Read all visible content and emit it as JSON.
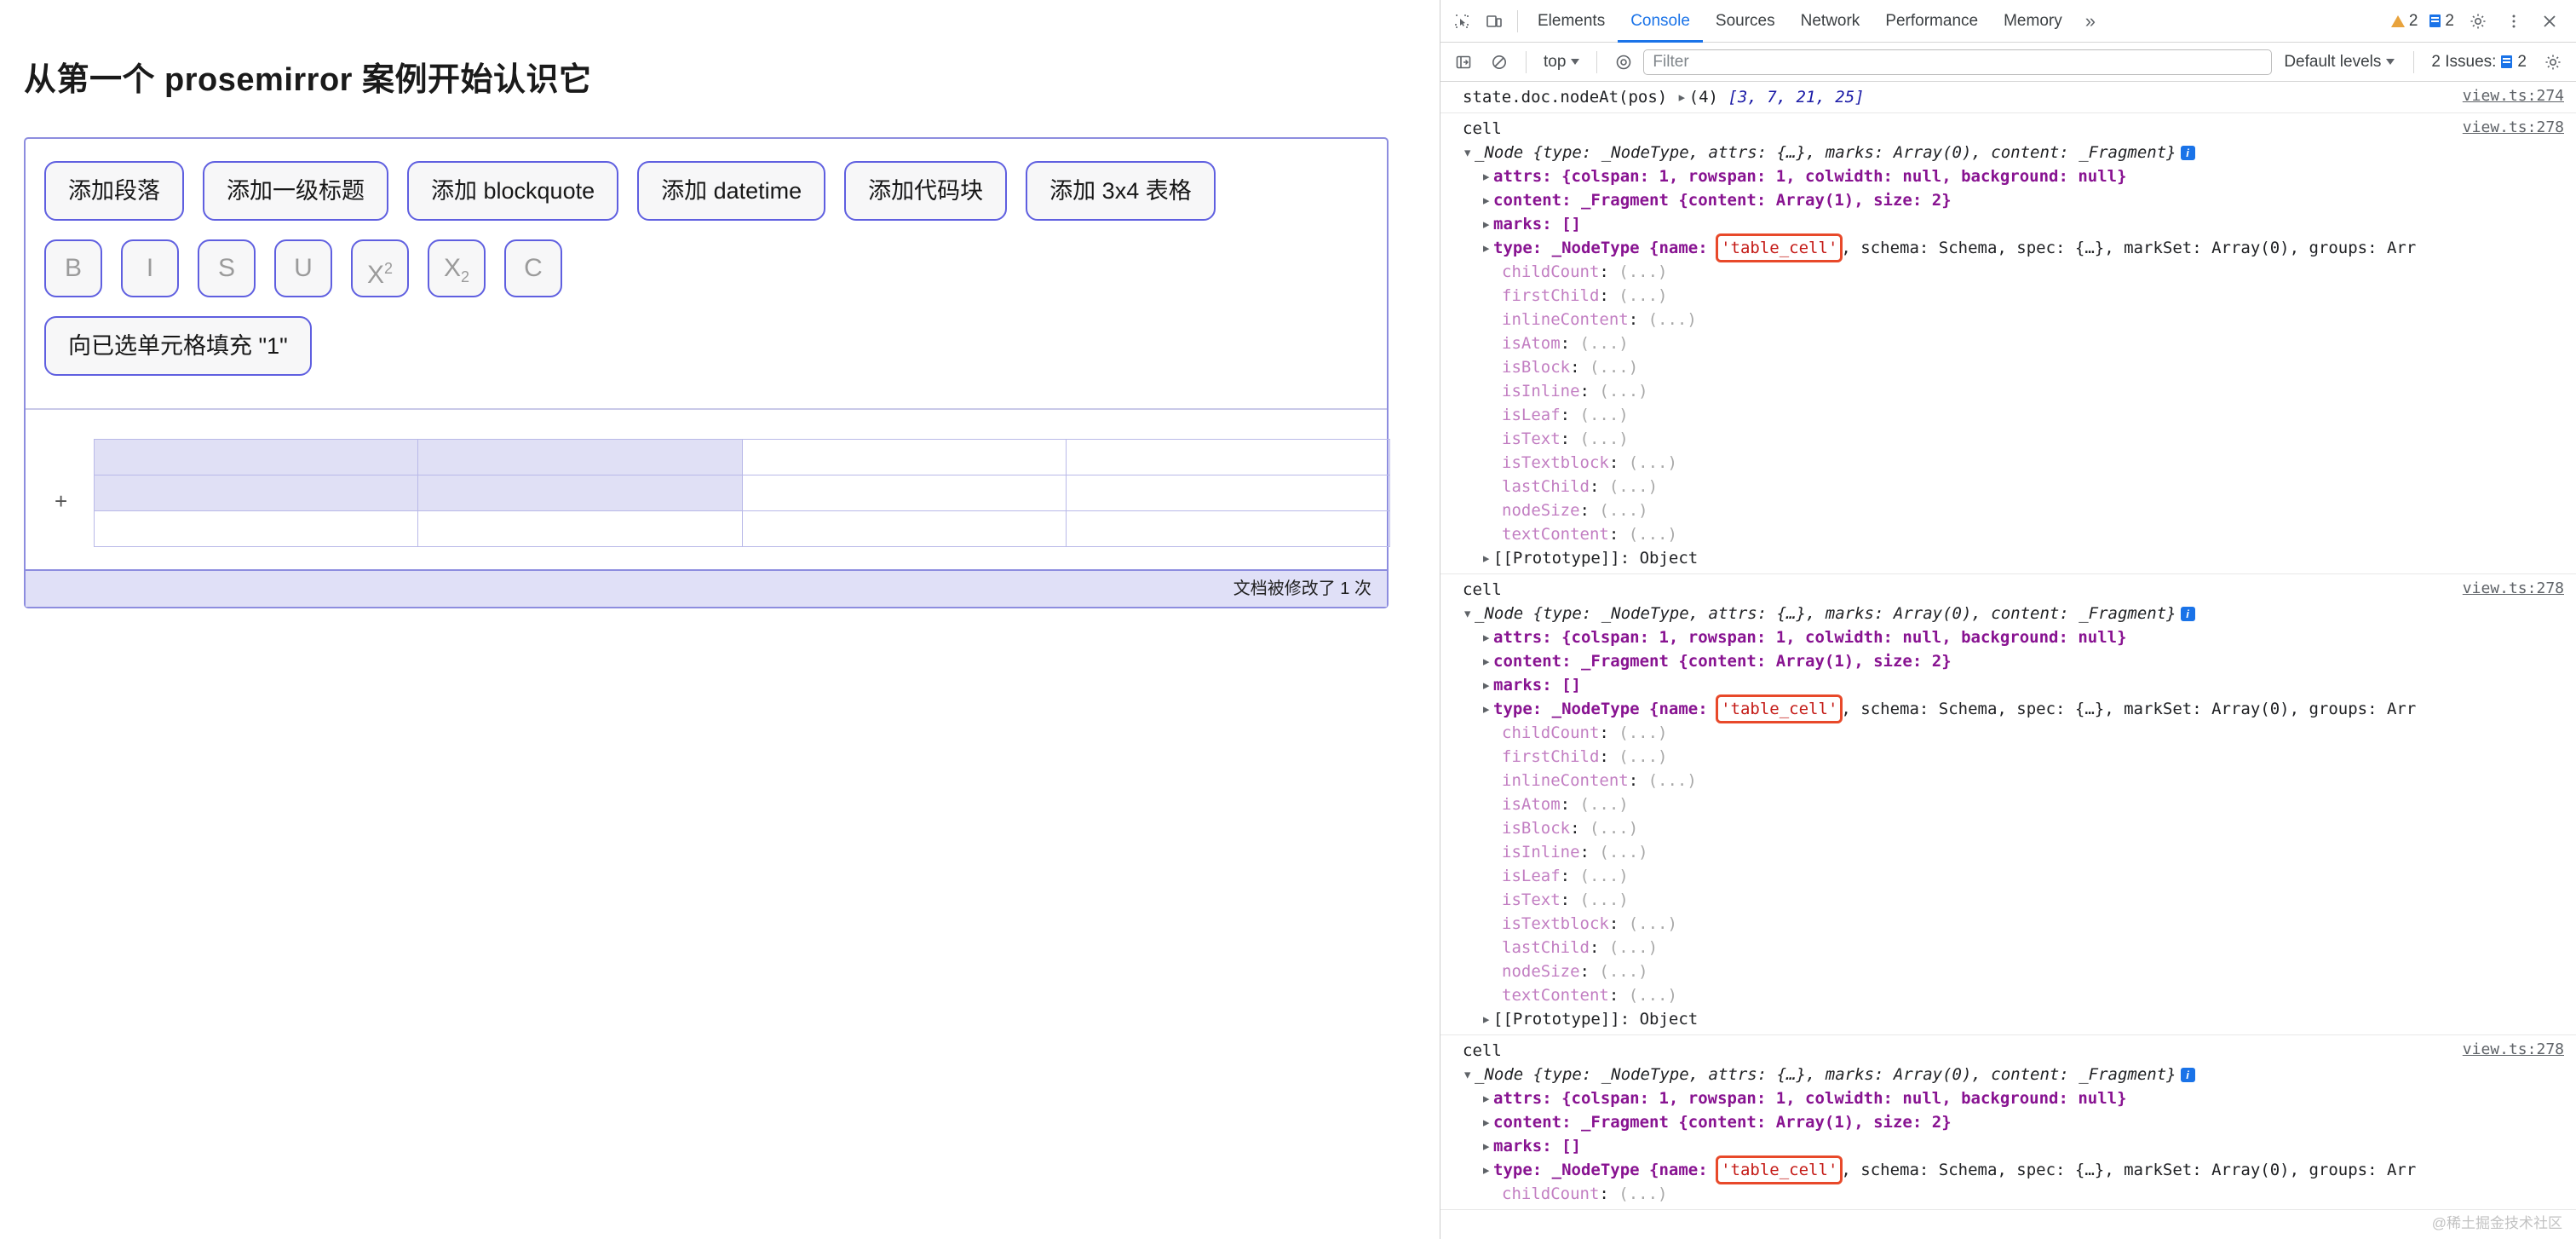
{
  "page": {
    "title": "从第一个 prosemirror 案例开始认识它",
    "block_buttons": [
      {
        "label": "添加段落"
      },
      {
        "label": "添加一级标题"
      },
      {
        "label": "添加 blockquote"
      },
      {
        "label": "添加 datetime"
      },
      {
        "label": "添加代码块"
      },
      {
        "label": "添加 3x4 表格"
      }
    ],
    "mark_buttons": [
      {
        "label": "B",
        "name": "bold"
      },
      {
        "label": "I",
        "name": "italic"
      },
      {
        "label": "S",
        "name": "strike"
      },
      {
        "label": "U",
        "name": "underline"
      },
      {
        "label": "X",
        "sup": "2",
        "name": "superscript"
      },
      {
        "label": "X",
        "sub": "2",
        "name": "subscript"
      },
      {
        "label": "C",
        "name": "code"
      }
    ],
    "fill_button": "向已选单元格填充 \"1\"",
    "plus_handle": "+",
    "status": "文档被修改了 1 次",
    "table": {
      "rows": 3,
      "cols": 4
    }
  },
  "devtools": {
    "tabs": [
      {
        "label": "Elements",
        "active": false
      },
      {
        "label": "Console",
        "active": true
      },
      {
        "label": "Sources",
        "active": false
      },
      {
        "label": "Network",
        "active": false
      },
      {
        "label": "Performance",
        "active": false
      },
      {
        "label": "Memory",
        "active": false
      }
    ],
    "more_tabs": "»",
    "warning_count": "2",
    "message_count": "2",
    "toolbar": {
      "context": "top",
      "filter_placeholder": "Filter",
      "filter_value": "",
      "levels": "Default levels",
      "issues_label": "2 Issues:",
      "issues_count": "2"
    },
    "console": {
      "entries": [
        {
          "kind": "expr",
          "source": "view.ts:274",
          "label": "state.doc.nodeAt(pos)",
          "count": "(4)",
          "array": "[3, 7, 21, 25]",
          "values": [
            "3",
            "7",
            "21",
            "25"
          ]
        },
        {
          "kind": "node",
          "source": "view.ts:278",
          "label": "cell",
          "header": "_Node {type: _NodeType, attrs: {…}, marks: Array(0), content: _Fragment}",
          "attrs": "attrs: {colspan: 1, rowspan: 1, colwidth: null, background: null}",
          "content": "content: _Fragment {content: Array(1), size: 2}",
          "marks": "marks: []",
          "type_prefix": "type: _NodeType {name: ",
          "type_value": "'table_cell'",
          "type_suffix": ", schema: Schema, spec: {…}, markSet: Array(0), groups: Arr",
          "props": [
            "childCount",
            "firstChild",
            "inlineContent",
            "isAtom",
            "isBlock",
            "isInline",
            "isLeaf",
            "isText",
            "isTextblock",
            "lastChild",
            "nodeSize",
            "textContent"
          ],
          "prop_value": "(...)",
          "prototype": "[[Prototype]]: Object"
        },
        {
          "kind": "node",
          "source": "view.ts:278",
          "label": "cell",
          "header": "_Node {type: _NodeType, attrs: {…}, marks: Array(0), content: _Fragment}",
          "attrs": "attrs: {colspan: 1, rowspan: 1, colwidth: null, background: null}",
          "content": "content: _Fragment {content: Array(1), size: 2}",
          "marks": "marks: []",
          "type_prefix": "type: _NodeType {name: ",
          "type_value": "'table_cell'",
          "type_suffix": ", schema: Schema, spec: {…}, markSet: Array(0), groups: Arr",
          "props": [
            "childCount",
            "firstChild",
            "inlineContent",
            "isAtom",
            "isBlock",
            "isInline",
            "isLeaf",
            "isText",
            "isTextblock",
            "lastChild",
            "nodeSize",
            "textContent"
          ],
          "prop_value": "(...)",
          "prototype": "[[Prototype]]: Object"
        },
        {
          "kind": "node-partial",
          "source": "view.ts:278",
          "label": "cell",
          "header": "_Node {type: _NodeType, attrs: {…}, marks: Array(0), content: _Fragment}",
          "attrs": "attrs: {colspan: 1, rowspan: 1, colwidth: null, background: null}",
          "content": "content: _Fragment {content: Array(1), size: 2}",
          "marks": "marks: []",
          "type_prefix": "type: _NodeType {name: ",
          "type_value": "'table_cell'",
          "type_suffix": ", schema: Schema, spec: {…}, markSet: Array(0), groups: Arr",
          "props": [
            "childCount"
          ],
          "prop_value": "(...)"
        }
      ]
    }
  },
  "watermark": "@稀土掘金技术社区"
}
